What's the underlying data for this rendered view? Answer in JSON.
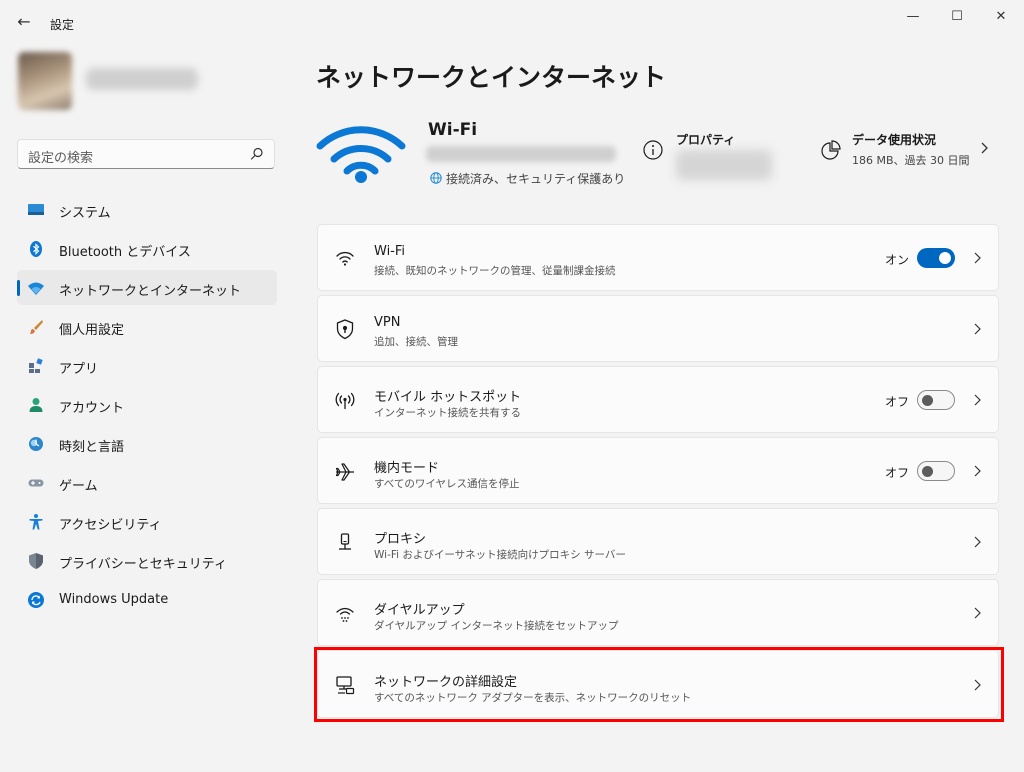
{
  "window": {
    "title": "設定",
    "back_glyph": "←",
    "minimize_glyph": "—",
    "maximize_glyph": "☐",
    "close_glyph": "✕"
  },
  "search": {
    "placeholder": "設定の検索"
  },
  "sidebar": {
    "items": [
      {
        "label": "システム",
        "icon": "system-icon"
      },
      {
        "label": "Bluetooth とデバイス",
        "icon": "bluetooth-icon"
      },
      {
        "label": "ネットワークとインターネット",
        "icon": "wifi-icon",
        "active": true
      },
      {
        "label": "個人用設定",
        "icon": "brush-icon"
      },
      {
        "label": "アプリ",
        "icon": "apps-icon"
      },
      {
        "label": "アカウント",
        "icon": "account-icon"
      },
      {
        "label": "時刻と言語",
        "icon": "time-language-icon"
      },
      {
        "label": "ゲーム",
        "icon": "gamepad-icon"
      },
      {
        "label": "アクセシビリティ",
        "icon": "accessibility-icon"
      },
      {
        "label": "プライバシーとセキュリティ",
        "icon": "shield-icon"
      },
      {
        "label": "Windows Update",
        "icon": "update-icon"
      }
    ]
  },
  "main": {
    "title": "ネットワークとインターネット",
    "hero": {
      "name": "Wi-Fi",
      "status": "接続済み、セキュリティ保護あり",
      "properties_label": "プロパティ",
      "data_usage_label": "データ使用状況",
      "data_usage_sub": "186 MB、過去 30 日間"
    },
    "cards": [
      {
        "title": "Wi-Fi",
        "desc": "接続、既知のネットワークの管理、従量制課金接続",
        "toggle_label": "オン",
        "toggle_on": true,
        "icon": "wifi-icon"
      },
      {
        "title": "VPN",
        "desc": "追加、接続、管理",
        "icon": "vpn-shield-icon"
      },
      {
        "title": "モバイル ホットスポット",
        "desc": "インターネット接続を共有する",
        "toggle_label": "オフ",
        "toggle_on": false,
        "icon": "hotspot-icon"
      },
      {
        "title": "機内モード",
        "desc": "すべてのワイヤレス通信を停止",
        "toggle_label": "オフ",
        "toggle_on": false,
        "icon": "airplane-icon"
      },
      {
        "title": "プロキシ",
        "desc": "Wi-Fi およびイーサネット接続向けプロキシ サーバー",
        "icon": "proxy-icon"
      },
      {
        "title": "ダイヤルアップ",
        "desc": "ダイヤルアップ インターネット接続をセットアップ",
        "icon": "dialup-icon"
      },
      {
        "title": "ネットワークの詳細設定",
        "desc": "すべてのネットワーク アダプターを表示、ネットワークのリセット",
        "icon": "network-adapter-icon",
        "highlighted": true
      }
    ]
  },
  "colors": {
    "accent": "#0067c0",
    "highlight": "#ff0000",
    "background": "#f3f3f3",
    "card": "#fbfbfb"
  }
}
